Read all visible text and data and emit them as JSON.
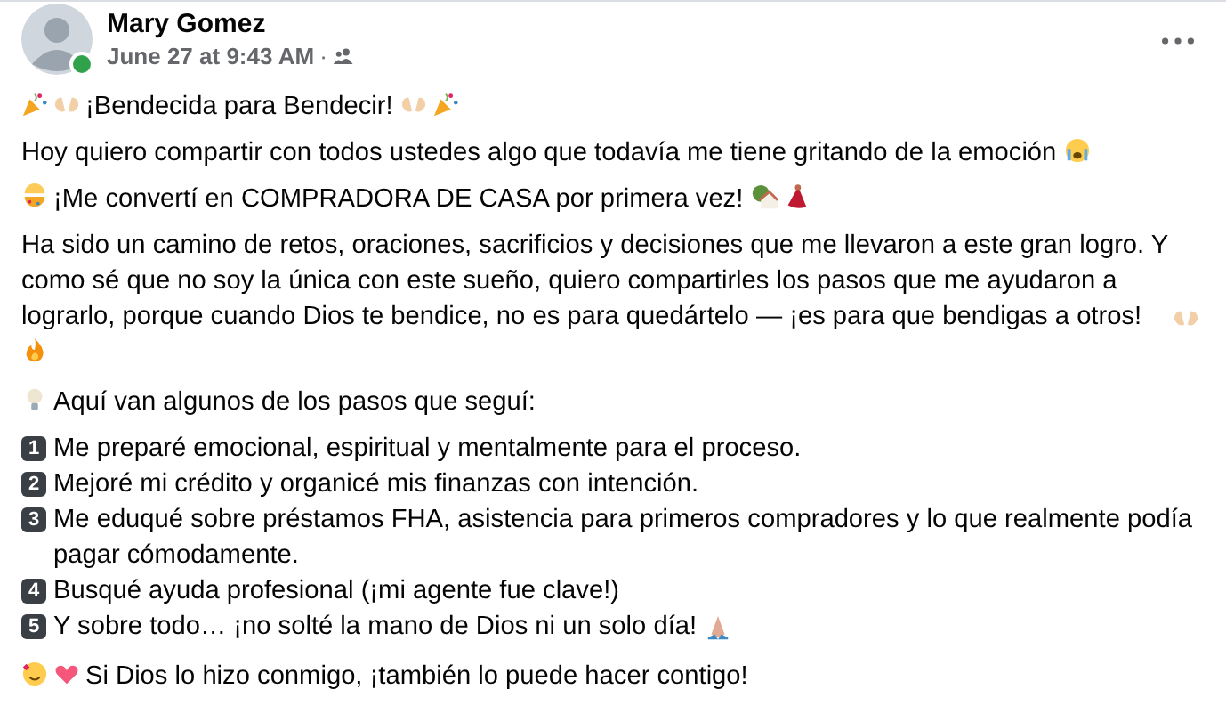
{
  "author": {
    "name": "Mary Gomez",
    "online": true
  },
  "timestamp": "June 27 at 9:43 AM",
  "separator": "·",
  "title": "¡Bendecida para Bendecir!",
  "intro": "Hoy quiero compartir con todos ustedes algo que todavía me tiene gritando de la emoción",
  "announcement": "¡Me convertí en COMPRADORA DE CASA por primera vez!",
  "story": "Ha sido un camino de retos, oraciones, sacrificios y decisiones que me llevaron a este gran logro. Y como sé que no soy la única con este sueño, quiero compartirles los pasos que me ayudaron a lograrlo, porque cuando Dios te bendice, no es para quedártelo — ¡es para que bendigas a otros!",
  "steps_heading": "Aquí van algunos de los pasos que seguí:",
  "steps": [
    {
      "number": "1",
      "text": "Me preparé emocional, espiritual y mentalmente para el proceso."
    },
    {
      "number": "2",
      "text": "Mejoré mi crédito y organicé mis finanzas con intención."
    },
    {
      "number": "3",
      "text": "Me eduqué sobre préstamos FHA, asistencia para primeros compradores y lo que realmente podía pagar cómodamente."
    },
    {
      "number": "4",
      "text": "Busqué ayuda profesional (¡mi agente fue clave!)"
    },
    {
      "number": "5",
      "text": "Y sobre todo… ¡no solté la mano de Dios ni un solo día!"
    }
  ],
  "closing": "Si Dios lo hizo conmigo, ¡también lo puede hacer contigo!"
}
